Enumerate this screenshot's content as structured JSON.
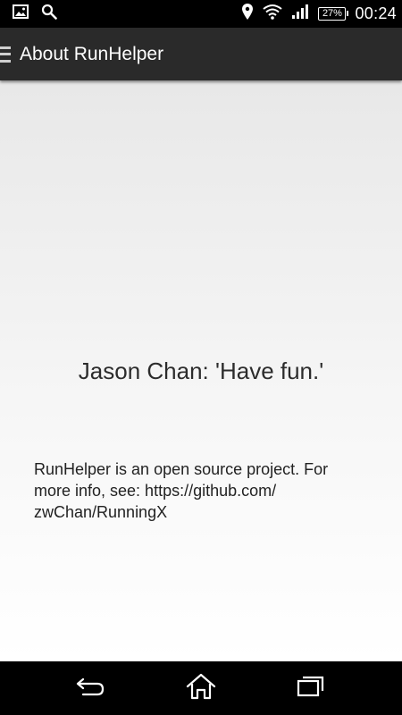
{
  "status_bar": {
    "icons_left": [
      "image-icon",
      "search-icon"
    ],
    "icons_right": [
      "location-icon",
      "wifi-icon",
      "signal-icon",
      "battery-icon"
    ],
    "battery_level": "27%",
    "time": "00:24"
  },
  "action_bar": {
    "title": "About RunHelper"
  },
  "content": {
    "motto": "Jason Chan: 'Have fun.'",
    "info_line1": "RunHelper is an open source project. For",
    "info_line2": "more info, see: https://github.com/",
    "info_line3": "zwChan/RunningX"
  },
  "nav_bar": {
    "buttons": [
      "back-icon",
      "home-icon",
      "recent-apps-icon"
    ]
  },
  "colors": {
    "status_bar_bg": "#000000",
    "action_bar_bg": "#2a2a2a",
    "content_bg": "#f2f2f2",
    "text": "#2c2c2c"
  }
}
